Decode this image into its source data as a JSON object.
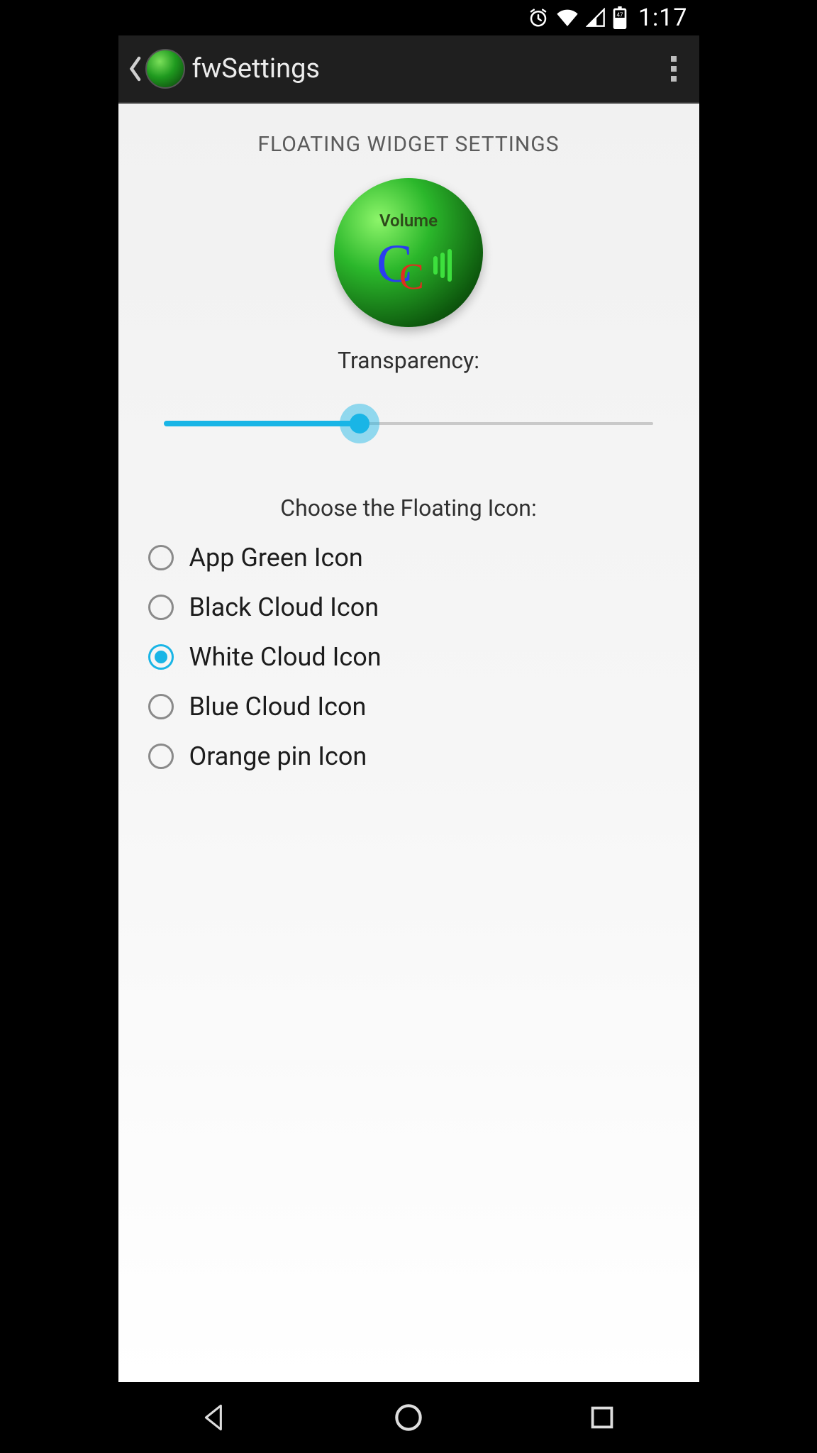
{
  "status": {
    "time": "1:17",
    "battery_text": "47"
  },
  "actionbar": {
    "title": "fwSettings"
  },
  "content": {
    "section_header": "FLOATING WIDGET SETTINGS",
    "preview_volume_text": "Volume",
    "transparency_label": "Transparency:",
    "transparency_value_percent": 40,
    "choose_label": "Choose the Floating Icon:"
  },
  "icon_options": [
    {
      "label": "App Green Icon",
      "checked": false
    },
    {
      "label": "Black Cloud Icon",
      "checked": false
    },
    {
      "label": "White Cloud Icon",
      "checked": true
    },
    {
      "label": "Blue Cloud Icon",
      "checked": false
    },
    {
      "label": "Orange pin Icon",
      "checked": false
    }
  ],
  "colors": {
    "accent": "#19b5e6",
    "actionbar_bg": "#1f1f1f",
    "content_bg": "#f3f3f3"
  }
}
